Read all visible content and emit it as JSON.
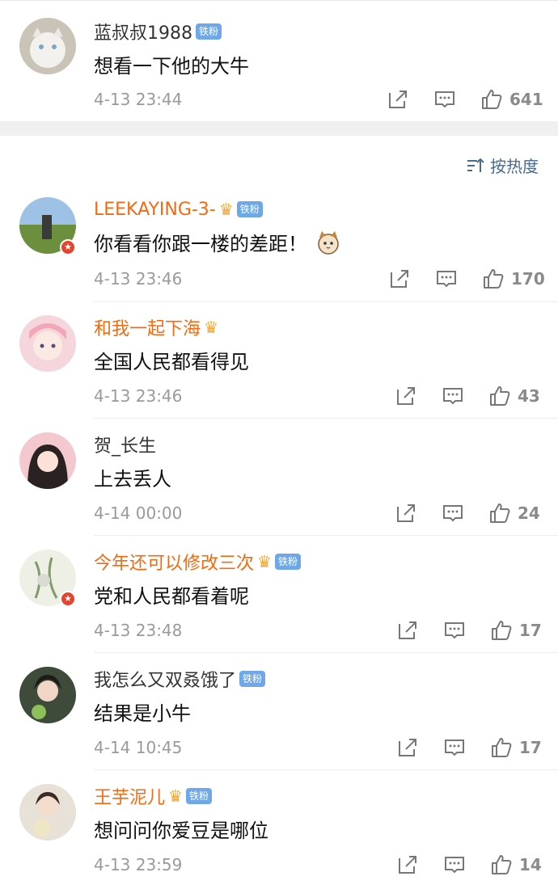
{
  "sort": {
    "label": "按热度"
  },
  "comments": [
    {
      "user": "蓝叔叔1988",
      "badge": "铁粉",
      "text": "想看一下他的大牛",
      "time": "4-13 23:44",
      "likes": "641"
    },
    {
      "user": "LEEKAYING-3-",
      "badge": "铁粉",
      "text": "你看看你跟一楼的差距！",
      "time": "4-13 23:46",
      "likes": "170"
    },
    {
      "user": "和我一起下海",
      "badge": "",
      "text": "全国人民都看得见",
      "time": "4-13 23:46",
      "likes": "43"
    },
    {
      "user": "贺_长生",
      "badge": "",
      "text": "上去丢人",
      "time": "4-14 00:00",
      "likes": "24"
    },
    {
      "user": "今年还可以修改三次",
      "badge": "铁粉",
      "text": "党和人民都看着呢",
      "time": "4-13 23:48",
      "likes": "17"
    },
    {
      "user": "我怎么又双叒饿了",
      "badge": "铁粉",
      "text": "结果是小牛",
      "time": "4-14 10:45",
      "likes": "17"
    },
    {
      "user": "王芋泥儿",
      "badge": "铁粉",
      "text": "想问问你爱豆是哪位",
      "time": "4-13 23:59",
      "likes": "14"
    }
  ],
  "icons": {
    "share": "share-icon",
    "comment": "comment-icon",
    "like": "thumbs-up-icon",
    "sort": "sort-icon",
    "crown": "crown-icon",
    "verified": "verified-badge-icon"
  },
  "colors": {
    "vip_name": "#f26b13",
    "fan_badge": "#6ea8e8",
    "sort_link": "#4a6a8e"
  }
}
